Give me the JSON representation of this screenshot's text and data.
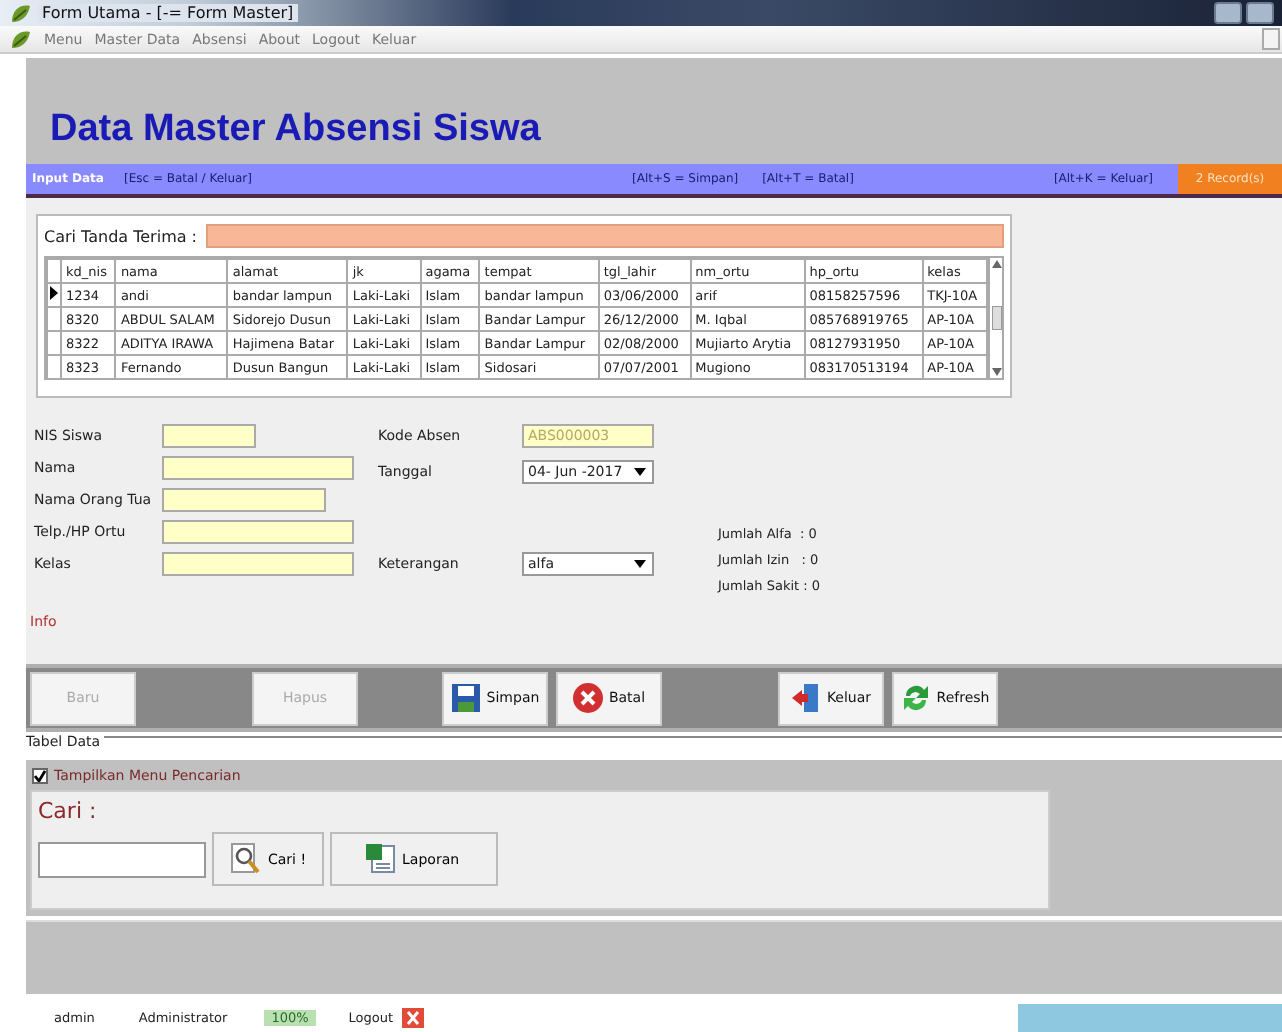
{
  "window": {
    "title": "Form Utama - [-= Form Master]"
  },
  "menu": [
    "Menu",
    "Master Data",
    "Absensi",
    "About",
    "Logout",
    "Keluar"
  ],
  "header": {
    "title": "Data Master Absensi Siswa"
  },
  "hint_bar": {
    "label": "Input Data",
    "hints": [
      "[Esc = Batal / Keluar]",
      "[Alt+S = Simpan]",
      "[Alt+T = Batal]",
      "[Alt+K = Keluar]"
    ],
    "record_count": "2 Record(s)"
  },
  "search": {
    "label": "Cari Tanda Terima :"
  },
  "table": {
    "columns": [
      "kd_nis",
      "nama",
      "alamat",
      "jk",
      "agama",
      "tempat",
      "tgl_lahir",
      "nm_ortu",
      "hp_ortu",
      "kelas"
    ],
    "rows": [
      {
        "selected": true,
        "cells": [
          "1234",
          "andi",
          "bandar lampun",
          "Laki-Laki",
          "Islam",
          "bandar lampun",
          "03/06/2000",
          "arif",
          "08158257596",
          "TKJ-10A"
        ]
      },
      {
        "selected": false,
        "cells": [
          "8320",
          "ABDUL SALAM",
          "Sidorejo Dusun",
          "Laki-Laki",
          "Islam",
          "Bandar Lampur",
          "26/12/2000",
          "M. Iqbal",
          "085768919765",
          "AP-10A"
        ]
      },
      {
        "selected": false,
        "cells": [
          "8322",
          "ADITYA IRAWA",
          "Hajimena Batar",
          "Laki-Laki",
          "Islam",
          "Bandar Lampur",
          "02/08/2000",
          "Mujiarto Arytia",
          "08127931950",
          "AP-10A"
        ]
      },
      {
        "selected": false,
        "cells": [
          "8323",
          "Fernando",
          "Dusun Bangun",
          "Laki-Laki",
          "Islam",
          "Sidosari",
          "07/07/2001",
          "Mugiono",
          "083170513194",
          "AP-10A"
        ]
      }
    ]
  },
  "form_left": [
    "NIS Siswa",
    "Nama",
    "Nama Orang Tua",
    "Telp./HP Ortu",
    "Kelas"
  ],
  "kode_absen": {
    "label": "Kode Absen",
    "value": "ABS000003"
  },
  "tanggal": {
    "label": "Tanggal",
    "value": "04- Jun -2017"
  },
  "keterangan": {
    "label": "Keterangan",
    "value": "alfa"
  },
  "totals": [
    "Jumlah Alfa  : 0",
    "Jumlah Izin   : 0",
    "Jumlah Sakit : 0"
  ],
  "info": "Info",
  "buttons": [
    {
      "label": "Baru",
      "disabled": true
    },
    {
      "label": "Hapus",
      "disabled": true
    },
    {
      "label": "Simpan",
      "disabled": false
    },
    {
      "label": "Batal",
      "disabled": false
    },
    {
      "label": "Keluar",
      "disabled": false
    },
    {
      "label": "Refresh",
      "disabled": false
    }
  ],
  "tabel_data": {
    "legend": "Tabel Data",
    "show_search": {
      "label": "Tampilkan Menu Pencarian",
      "checked": true
    },
    "search_label": "Cari :",
    "buttons": [
      "Cari !",
      "Laporan"
    ]
  },
  "status_bar": [
    "admin",
    "Administrator",
    "100%",
    "Logout"
  ]
}
